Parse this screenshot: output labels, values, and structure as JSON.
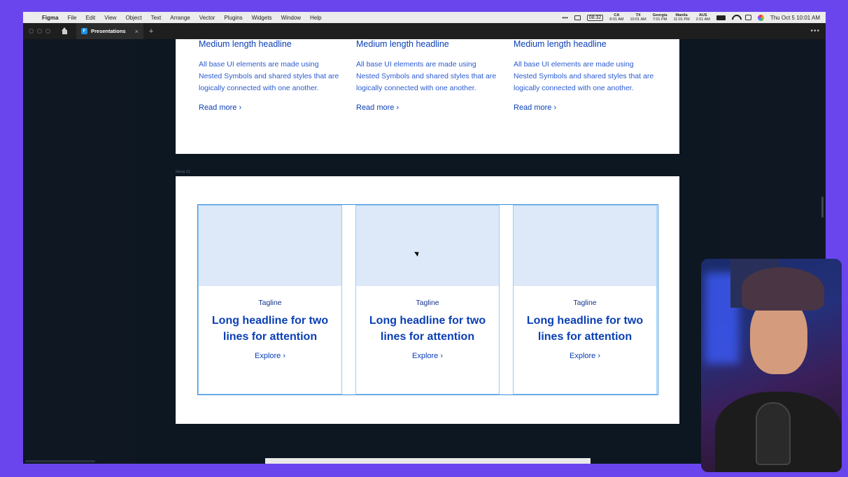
{
  "menubar": {
    "app": "Figma",
    "items": [
      "File",
      "Edit",
      "View",
      "Object",
      "Text",
      "Arrange",
      "Vector",
      "Plugins",
      "Widgets",
      "Window",
      "Help"
    ],
    "timer": "08:32",
    "timezones": [
      {
        "label": "CA",
        "time": "8:01 AM"
      },
      {
        "label": "TX",
        "time": "10:01 AM"
      },
      {
        "label": "Georgia",
        "time": "7:01 PM"
      },
      {
        "label": "Manila",
        "time": "11:01 PM"
      },
      {
        "label": "AUS",
        "time": "2:01 AM"
      }
    ],
    "datetime": "Thu Oct 5  10:01 AM"
  },
  "figma": {
    "tab_label": "Presentations",
    "frame_label": "Items 11"
  },
  "top_frame": {
    "columns": [
      {
        "headline": "Medium length headline",
        "body": "All base UI elements are made using Nested Symbols and shared styles that are logically connected with one another.",
        "link": "Read more"
      },
      {
        "headline": "Medium length headline",
        "body": "All base UI elements are made using Nested Symbols and shared styles that are logically connected with one another.",
        "link": "Read more"
      },
      {
        "headline": "Medium length headline",
        "body": "All base UI elements are made using Nested Symbols and shared styles that are logically connected with one another.",
        "link": "Read more"
      }
    ]
  },
  "cards": [
    {
      "tagline": "Tagline",
      "headline": "Long headline for two lines for attention",
      "cta": "Explore"
    },
    {
      "tagline": "Tagline",
      "headline": "Long headline for two lines for attention",
      "cta": "Explore"
    },
    {
      "tagline": "Tagline",
      "headline": "Long headline for two lines for attention",
      "cta": "Explore"
    }
  ],
  "colors": {
    "accent": "#0a3fb5",
    "selection": "#3a8fe0",
    "placeholder": "#dde9f9",
    "background": "#6a45ee"
  }
}
